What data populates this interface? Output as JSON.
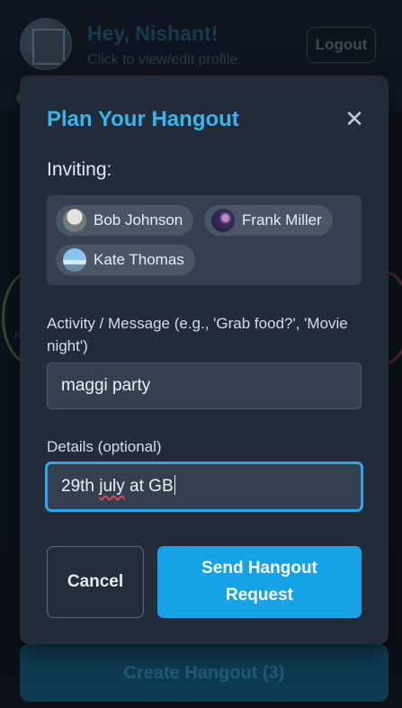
{
  "header": {
    "greeting": "Hey, Nishant!",
    "subtitle": "Click to view/edit profile.",
    "logout_label": "Logout"
  },
  "background": {
    "side_letter": "K",
    "create_label": "Create Hangout (3)"
  },
  "modal": {
    "title": "Plan Your Hangout",
    "close_glyph": "✕",
    "inviting_label": "Inviting:",
    "invitees": [
      {
        "name": "Bob Johnson"
      },
      {
        "name": "Frank Miller"
      },
      {
        "name": "Kate Thomas"
      }
    ],
    "activity": {
      "label": "Activity / Message (e.g., 'Grab food?', 'Movie night')",
      "value": "maggi party"
    },
    "details": {
      "label": "Details (optional)",
      "value_pre": "29th ",
      "value_misspelled": "july",
      "value_post": " at GB"
    },
    "cancel_label": "Cancel",
    "send_label": "Send Hangout Request"
  },
  "colors": {
    "accent": "#38b5f0",
    "primary_button": "#13a3e6",
    "modal_bg": "#222b3a",
    "focus_border": "#2ba7e8"
  }
}
